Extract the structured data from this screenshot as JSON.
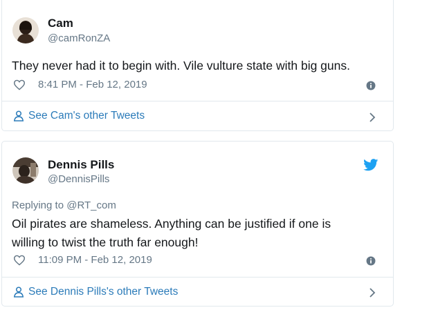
{
  "tweets": [
    {
      "name": "Cam",
      "handle": "@camRonZA",
      "replying_to": "",
      "text_lines": [
        "They never had it to begin with. Vile vulture state with big guns."
      ],
      "timestamp": "8:41 PM - Feb 12, 2019",
      "footer_link": "See Cam's other Tweets",
      "avatar_icon": "avatar-photo",
      "has_twitter_logo": false
    },
    {
      "name": "Dennis Pills",
      "handle": "@DennisPills",
      "replying_to": "Replying to @RT_com",
      "text_lines": [
        "Oil pirates are shameless. Anything can be justified if one is",
        "willing to twist the truth far enough!"
      ],
      "timestamp": "11:09 PM - Feb 12, 2019",
      "footer_link": "See Dennis Pills's other Tweets",
      "avatar_icon": "avatar-photo",
      "has_twitter_logo": true
    }
  ],
  "colors": {
    "link": "#2b7bb9",
    "muted": "#657786",
    "text": "#14171a",
    "border": "#e1e8ed",
    "twitter_blue": "#1da1f2"
  }
}
